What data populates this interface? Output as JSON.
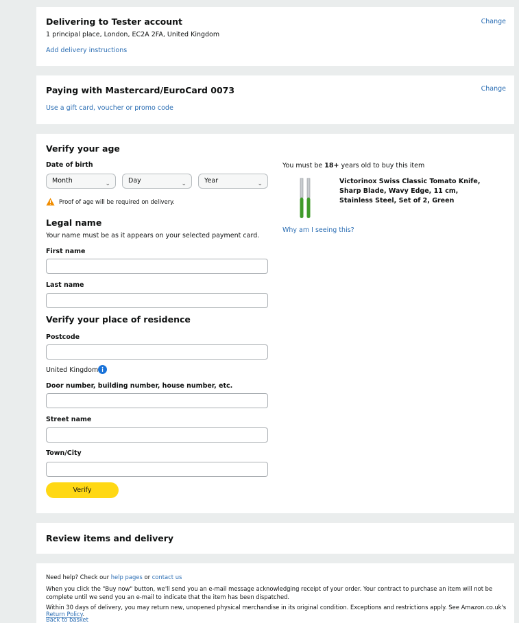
{
  "delivery": {
    "title": "Delivering to Tester account",
    "address": "1 principal place, London, EC2A 2FA, United Kingdom",
    "instructions_link": "Add delivery instructions",
    "change_label": "Change"
  },
  "payment": {
    "title": "Paying with Mastercard/EuroCard 0073",
    "gift_link": "Use a gift card, voucher or promo code",
    "change_label": "Change"
  },
  "verify": {
    "title": "Verify your age",
    "dob_label": "Date of birth",
    "month": "Month",
    "day": "Day",
    "year": "Year",
    "proof_note": "Proof of age will be required on delivery.",
    "legal_title": "Legal name",
    "legal_desc": "Your name must be as it appears on your selected payment card.",
    "first_name_label": "First name",
    "last_name_label": "Last name",
    "residence_title": "Verify your place of residence",
    "postcode_label": "Postcode",
    "country": "United Kingdom",
    "door_label": "Door number, building number, house number, etc.",
    "street_label": "Street name",
    "town_label": "Town/City",
    "verify_button": "Verify"
  },
  "age_notice": {
    "prefix": "You must be ",
    "age": "18+",
    "suffix": " years old to buy this item",
    "product_title": "Victorinox Swiss Classic Tomato Knife, Sharp Blade, Wavy Edge, 11 cm, Stainless Steel, Set of 2, Green",
    "why_link": "Why am I seeing this?"
  },
  "review": {
    "title": "Review items and delivery"
  },
  "footer": {
    "help_prefix": "Need help? Check our ",
    "help_pages": "help pages",
    "or": " or ",
    "contact": "contact us",
    "buy_now_text": "When you click the \"Buy now\" button, we'll send you an e-mail message acknowledging receipt of your order. Your contract to purchase an item will not be complete until we send you an e-mail to indicate that the item has been dispatched.",
    "return_text": "Within 30 days of delivery, you may return new, unopened physical merchandise in its original condition. Exceptions and restrictions apply. See Amazon.co.uk's ",
    "return_link": "Return Policy",
    "return_end": ".",
    "back_link": "Back to basket"
  },
  "colors": {
    "link": "#2a6db3",
    "button": "#ffd814",
    "warning": "#f08c00",
    "info": "#1a73d9",
    "knife_handle": "#3f9a2a"
  }
}
